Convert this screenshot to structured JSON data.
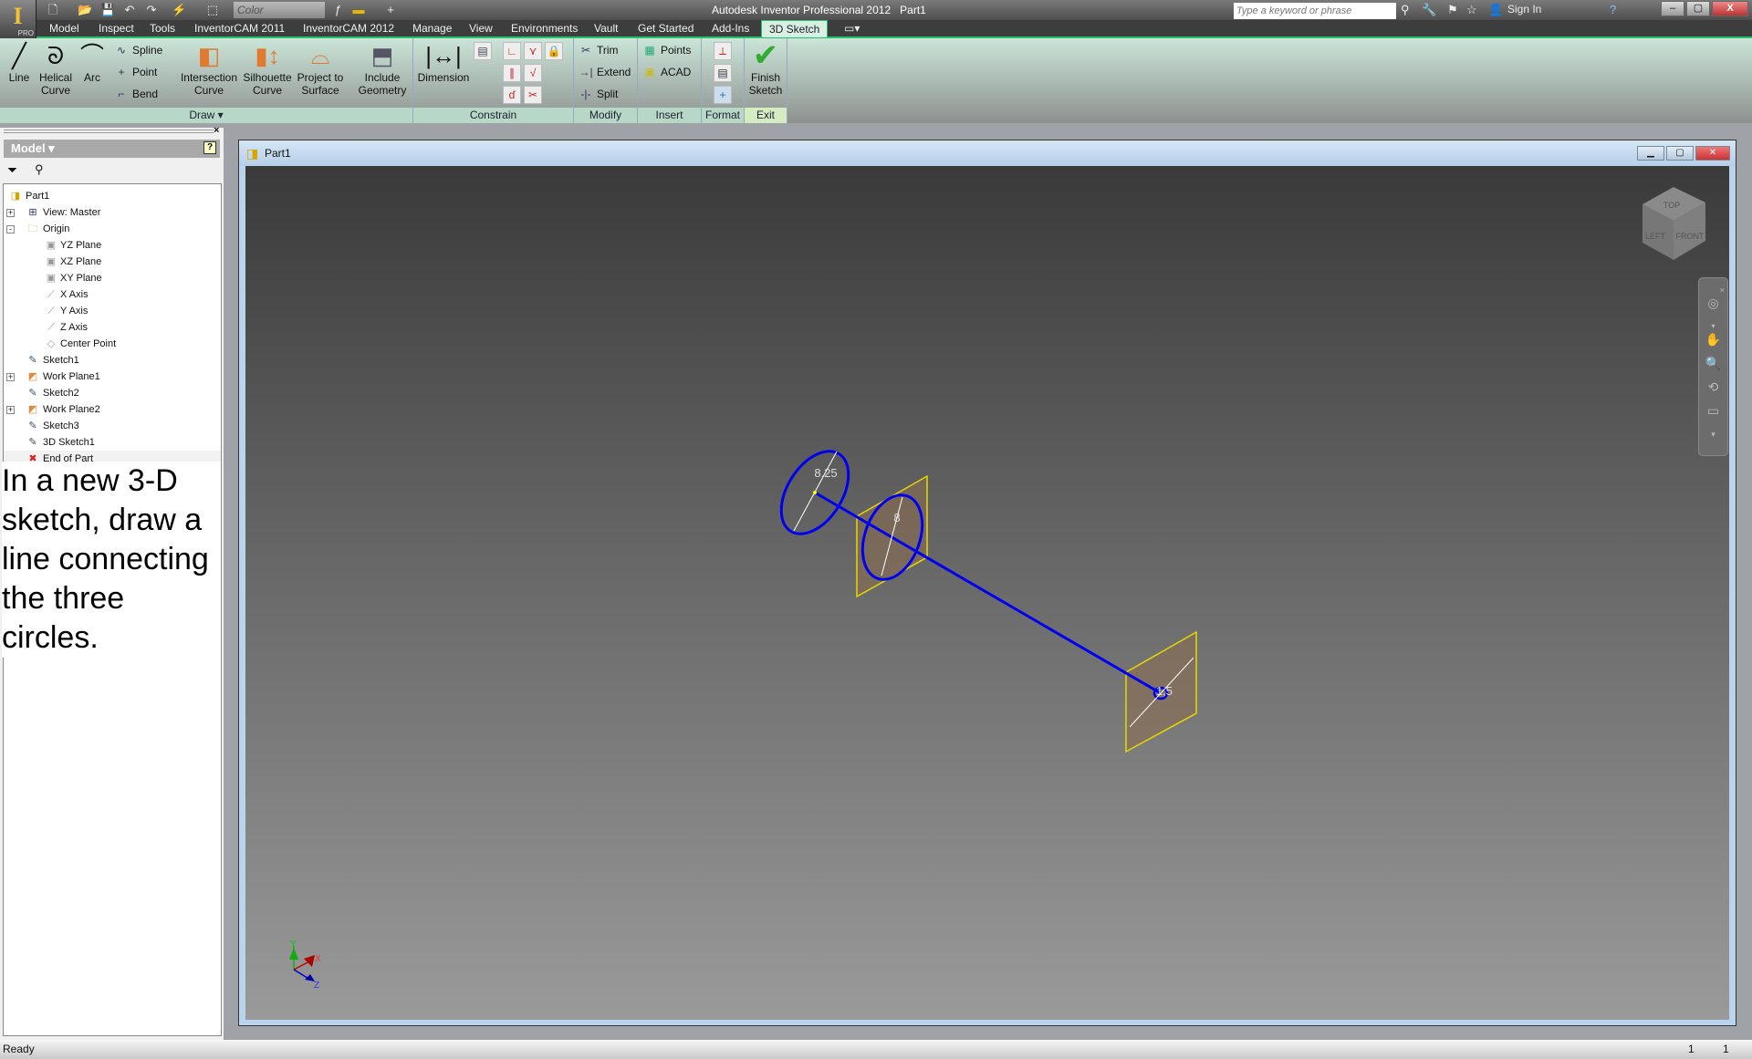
{
  "app": {
    "title": "Autodesk Inventor Professional 2012",
    "document": "Part1",
    "app_button_badge": "PRO",
    "color_dropdown": "Color"
  },
  "search": {
    "placeholder": "Type a keyword or phrase",
    "sign_in": "Sign In"
  },
  "menu": {
    "tabs": [
      "Model",
      "Inspect",
      "Tools",
      "InventorCAM 2011",
      "InventorCAM 2012",
      "Manage",
      "View",
      "Environments",
      "Vault",
      "Get Started",
      "Add-Ins",
      "3D Sketch"
    ],
    "active": "3D Sketch"
  },
  "ribbon": {
    "draw": {
      "label": "Draw",
      "line": "Line",
      "helical": "Helical Curve",
      "arc": "Arc",
      "spline": "Spline",
      "point": "Point",
      "bend": "Bend",
      "intersection": "Intersection Curve",
      "silhouette": "Silhouette Curve",
      "project": "Project to Surface",
      "include": "Include Geometry"
    },
    "constrain": {
      "label": "Constrain",
      "dimension": "Dimension"
    },
    "modify": {
      "label": "Modify",
      "trim": "Trim",
      "extend": "Extend",
      "split": "Split"
    },
    "insert": {
      "label": "Insert",
      "points": "Points",
      "acad": "ACAD"
    },
    "format": {
      "label": "Format"
    },
    "exit": {
      "label": "Exit",
      "finish": "Finish Sketch"
    }
  },
  "browser": {
    "title": "Model",
    "items": [
      {
        "label": "Part1",
        "level": 0,
        "icon": "part-icon"
      },
      {
        "label": "View: Master",
        "level": 1,
        "icon": "view-icon",
        "expander": "+"
      },
      {
        "label": "Origin",
        "level": 1,
        "icon": "folder-icon",
        "expander": "-"
      },
      {
        "label": "YZ Plane",
        "level": 2,
        "icon": "plane-icon"
      },
      {
        "label": "XZ Plane",
        "level": 2,
        "icon": "plane-icon"
      },
      {
        "label": "XY Plane",
        "level": 2,
        "icon": "plane-icon"
      },
      {
        "label": "X Axis",
        "level": 2,
        "icon": "axis-icon"
      },
      {
        "label": "Y Axis",
        "level": 2,
        "icon": "axis-icon"
      },
      {
        "label": "Z Axis",
        "level": 2,
        "icon": "axis-icon"
      },
      {
        "label": "Center Point",
        "level": 2,
        "icon": "point-icon"
      },
      {
        "label": "Sketch1",
        "level": 1,
        "icon": "sketch-icon"
      },
      {
        "label": "Work Plane1",
        "level": 1,
        "icon": "workplane-icon",
        "expander": "+"
      },
      {
        "label": "Sketch2",
        "level": 1,
        "icon": "sketch-icon"
      },
      {
        "label": "Work Plane2",
        "level": 1,
        "icon": "workplane-icon",
        "expander": "+"
      },
      {
        "label": "Sketch3",
        "level": 1,
        "icon": "sketch-icon"
      },
      {
        "label": "3D Sketch1",
        "level": 1,
        "icon": "3d-sketch-icon",
        "selected": true
      },
      {
        "label": "End of Part",
        "level": 1,
        "icon": "end-of-part-icon"
      }
    ]
  },
  "instruction": [
    "In a new 3-D",
    "sketch, draw a",
    "line connecting",
    "the three",
    "circles."
  ],
  "viewport": {
    "dimensions": [
      "8,25",
      "8",
      "1,5"
    ],
    "viewcube": {
      "top": "TOP",
      "left": "LEFT",
      "front": "FRONT"
    },
    "triad": {
      "x": "X",
      "y": "Y",
      "z": "Z"
    },
    "sketch_color": "#0000ee",
    "plane_color": "#e8d800"
  },
  "status": {
    "text": "Ready",
    "right1": "1",
    "right2": "1"
  }
}
